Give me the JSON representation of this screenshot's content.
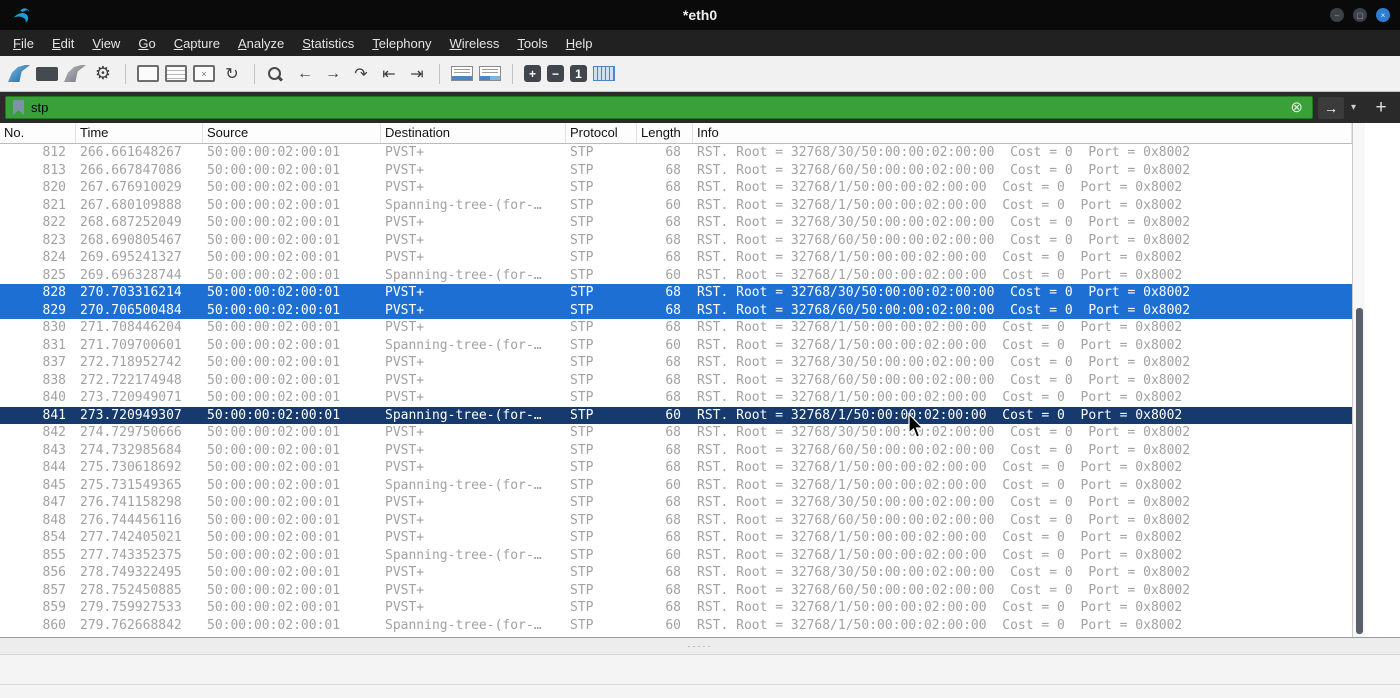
{
  "window": {
    "title": "*eth0"
  },
  "menu": {
    "items": [
      "File",
      "Edit",
      "View",
      "Go",
      "Capture",
      "Analyze",
      "Statistics",
      "Telephony",
      "Wireless",
      "Tools",
      "Help"
    ]
  },
  "toolbar": {
    "items": [
      {
        "name": "start-capture",
        "cls": "i-fin i-fin-blue",
        "glyph": ""
      },
      {
        "name": "stop-capture",
        "cls": "i-stop",
        "glyph": ""
      },
      {
        "name": "restart-capture",
        "cls": "i-fin i-fin-gray",
        "glyph": ""
      },
      {
        "name": "capture-options",
        "cls": "i-gear",
        "glyph": "⚙"
      },
      {
        "sep": true
      },
      {
        "name": "open-file",
        "cls": "i-doc",
        "glyph": ""
      },
      {
        "name": "save-file",
        "cls": "i-doc i-doc-grid",
        "glyph": ""
      },
      {
        "name": "close-file",
        "cls": "i-doc",
        "glyph": "×"
      },
      {
        "name": "reload-file",
        "cls": "",
        "glyph": "↻"
      },
      {
        "sep": true
      },
      {
        "name": "find-packet",
        "cls": "i-mag",
        "glyph": ""
      },
      {
        "name": "previous-packet",
        "cls": "",
        "glyph": "←"
      },
      {
        "name": "next-packet",
        "cls": "",
        "glyph": "→"
      },
      {
        "name": "goto-packet",
        "cls": "",
        "glyph": "↷"
      },
      {
        "name": "first-packet",
        "cls": "",
        "glyph": "⇤"
      },
      {
        "name": "last-packet",
        "cls": "",
        "glyph": "⇥"
      },
      {
        "sep": true
      },
      {
        "name": "autoscroll",
        "cls": "i-panel i-panel-blue",
        "glyph": ""
      },
      {
        "name": "colorize",
        "cls": "i-panel i-panel-color",
        "glyph": ""
      },
      {
        "sep": true
      },
      {
        "name": "zoom-in",
        "cls": "i-zoom",
        "glyph": "+"
      },
      {
        "name": "zoom-out",
        "cls": "i-zoom",
        "glyph": "−"
      },
      {
        "name": "zoom-100",
        "cls": "i-zoom",
        "glyph": "1"
      },
      {
        "name": "resize-columns",
        "cls": "i-grid",
        "glyph": ""
      }
    ]
  },
  "filter": {
    "value": "stp",
    "clear_glyph": "⊗",
    "apply_glyph": "→",
    "caret_glyph": "▾",
    "add_glyph": "+"
  },
  "columns": [
    "No.",
    "Time",
    "Source",
    "Destination",
    "Protocol",
    "Length",
    "Info"
  ],
  "packets": [
    {
      "no": "812",
      "time": "266.661648267",
      "src": "50:00:00:02:00:01",
      "dst": "PVST+",
      "proto": "STP",
      "len": "68",
      "info": "RST. Root = 32768/30/50:00:00:02:00:00  Cost = 0  Port = 0x8002",
      "state": "normal"
    },
    {
      "no": "813",
      "time": "266.667847086",
      "src": "50:00:00:02:00:01",
      "dst": "PVST+",
      "proto": "STP",
      "len": "68",
      "info": "RST. Root = 32768/60/50:00:00:02:00:00  Cost = 0  Port = 0x8002",
      "state": "normal"
    },
    {
      "no": "820",
      "time": "267.676910029",
      "src": "50:00:00:02:00:01",
      "dst": "PVST+",
      "proto": "STP",
      "len": "68",
      "info": "RST. Root = 32768/1/50:00:00:02:00:00  Cost = 0  Port = 0x8002",
      "state": "normal"
    },
    {
      "no": "821",
      "time": "267.680109888",
      "src": "50:00:00:02:00:01",
      "dst": "Spanning-tree-(for-…",
      "proto": "STP",
      "len": "60",
      "info": "RST. Root = 32768/1/50:00:00:02:00:00  Cost = 0  Port = 0x8002",
      "state": "normal"
    },
    {
      "no": "822",
      "time": "268.687252049",
      "src": "50:00:00:02:00:01",
      "dst": "PVST+",
      "proto": "STP",
      "len": "68",
      "info": "RST. Root = 32768/30/50:00:00:02:00:00  Cost = 0  Port = 0x8002",
      "state": "normal"
    },
    {
      "no": "823",
      "time": "268.690805467",
      "src": "50:00:00:02:00:01",
      "dst": "PVST+",
      "proto": "STP",
      "len": "68",
      "info": "RST. Root = 32768/60/50:00:00:02:00:00  Cost = 0  Port = 0x8002",
      "state": "normal"
    },
    {
      "no": "824",
      "time": "269.695241327",
      "src": "50:00:00:02:00:01",
      "dst": "PVST+",
      "proto": "STP",
      "len": "68",
      "info": "RST. Root = 32768/1/50:00:00:02:00:00  Cost = 0  Port = 0x8002",
      "state": "normal"
    },
    {
      "no": "825",
      "time": "269.696328744",
      "src": "50:00:00:02:00:01",
      "dst": "Spanning-tree-(for-…",
      "proto": "STP",
      "len": "60",
      "info": "RST. Root = 32768/1/50:00:00:02:00:00  Cost = 0  Port = 0x8002",
      "state": "normal"
    },
    {
      "no": "828",
      "time": "270.703316214",
      "src": "50:00:00:02:00:01",
      "dst": "PVST+",
      "proto": "STP",
      "len": "68",
      "info": "RST. Root = 32768/30/50:00:00:02:00:00  Cost = 0  Port = 0x8002",
      "state": "selected"
    },
    {
      "no": "829",
      "time": "270.706500484",
      "src": "50:00:00:02:00:01",
      "dst": "PVST+",
      "proto": "STP",
      "len": "68",
      "info": "RST. Root = 32768/60/50:00:00:02:00:00  Cost = 0  Port = 0x8002",
      "state": "selected"
    },
    {
      "no": "830",
      "time": "271.708446204",
      "src": "50:00:00:02:00:01",
      "dst": "PVST+",
      "proto": "STP",
      "len": "68",
      "info": "RST. Root = 32768/1/50:00:00:02:00:00  Cost = 0  Port = 0x8002",
      "state": "normal"
    },
    {
      "no": "831",
      "time": "271.709700601",
      "src": "50:00:00:02:00:01",
      "dst": "Spanning-tree-(for-…",
      "proto": "STP",
      "len": "60",
      "info": "RST. Root = 32768/1/50:00:00:02:00:00  Cost = 0  Port = 0x8002",
      "state": "normal"
    },
    {
      "no": "837",
      "time": "272.718952742",
      "src": "50:00:00:02:00:01",
      "dst": "PVST+",
      "proto": "STP",
      "len": "68",
      "info": "RST. Root = 32768/30/50:00:00:02:00:00  Cost = 0  Port = 0x8002",
      "state": "normal"
    },
    {
      "no": "838",
      "time": "272.722174948",
      "src": "50:00:00:02:00:01",
      "dst": "PVST+",
      "proto": "STP",
      "len": "68",
      "info": "RST. Root = 32768/60/50:00:00:02:00:00  Cost = 0  Port = 0x8002",
      "state": "normal"
    },
    {
      "no": "840",
      "time": "273.720949071",
      "src": "50:00:00:02:00:01",
      "dst": "PVST+",
      "proto": "STP",
      "len": "68",
      "info": "RST. Root = 32768/1/50:00:00:02:00:00  Cost = 0  Port = 0x8002",
      "state": "normal"
    },
    {
      "no": "841",
      "time": "273.720949307",
      "src": "50:00:00:02:00:01",
      "dst": "Spanning-tree-(for-…",
      "proto": "STP",
      "len": "60",
      "info": "RST. Root = 32768/1/50:00:00:02:00:00  Cost = 0  Port = 0x8002",
      "state": "current"
    },
    {
      "no": "842",
      "time": "274.729750666",
      "src": "50:00:00:02:00:01",
      "dst": "PVST+",
      "proto": "STP",
      "len": "68",
      "info": "RST. Root = 32768/30/50:00:00:02:00:00  Cost = 0  Port = 0x8002",
      "state": "normal"
    },
    {
      "no": "843",
      "time": "274.732985684",
      "src": "50:00:00:02:00:01",
      "dst": "PVST+",
      "proto": "STP",
      "len": "68",
      "info": "RST. Root = 32768/60/50:00:00:02:00:00  Cost = 0  Port = 0x8002",
      "state": "normal"
    },
    {
      "no": "844",
      "time": "275.730618692",
      "src": "50:00:00:02:00:01",
      "dst": "PVST+",
      "proto": "STP",
      "len": "68",
      "info": "RST. Root = 32768/1/50:00:00:02:00:00  Cost = 0  Port = 0x8002",
      "state": "normal"
    },
    {
      "no": "845",
      "time": "275.731549365",
      "src": "50:00:00:02:00:01",
      "dst": "Spanning-tree-(for-…",
      "proto": "STP",
      "len": "60",
      "info": "RST. Root = 32768/1/50:00:00:02:00:00  Cost = 0  Port = 0x8002",
      "state": "normal"
    },
    {
      "no": "847",
      "time": "276.741158298",
      "src": "50:00:00:02:00:01",
      "dst": "PVST+",
      "proto": "STP",
      "len": "68",
      "info": "RST. Root = 32768/30/50:00:00:02:00:00  Cost = 0  Port = 0x8002",
      "state": "normal"
    },
    {
      "no": "848",
      "time": "276.744456116",
      "src": "50:00:00:02:00:01",
      "dst": "PVST+",
      "proto": "STP",
      "len": "68",
      "info": "RST. Root = 32768/60/50:00:00:02:00:00  Cost = 0  Port = 0x8002",
      "state": "normal"
    },
    {
      "no": "854",
      "time": "277.742405021",
      "src": "50:00:00:02:00:01",
      "dst": "PVST+",
      "proto": "STP",
      "len": "68",
      "info": "RST. Root = 32768/1/50:00:00:02:00:00  Cost = 0  Port = 0x8002",
      "state": "normal"
    },
    {
      "no": "855",
      "time": "277.743352375",
      "src": "50:00:00:02:00:01",
      "dst": "Spanning-tree-(for-…",
      "proto": "STP",
      "len": "60",
      "info": "RST. Root = 32768/1/50:00:00:02:00:00  Cost = 0  Port = 0x8002",
      "state": "normal"
    },
    {
      "no": "856",
      "time": "278.749322495",
      "src": "50:00:00:02:00:01",
      "dst": "PVST+",
      "proto": "STP",
      "len": "68",
      "info": "RST. Root = 32768/30/50:00:00:02:00:00  Cost = 0  Port = 0x8002",
      "state": "normal"
    },
    {
      "no": "857",
      "time": "278.752450885",
      "src": "50:00:00:02:00:01",
      "dst": "PVST+",
      "proto": "STP",
      "len": "68",
      "info": "RST. Root = 32768/60/50:00:00:02:00:00  Cost = 0  Port = 0x8002",
      "state": "normal"
    },
    {
      "no": "859",
      "time": "279.759927533",
      "src": "50:00:00:02:00:01",
      "dst": "PVST+",
      "proto": "STP",
      "len": "68",
      "info": "RST. Root = 32768/1/50:00:00:02:00:00  Cost = 0  Port = 0x8002",
      "state": "normal"
    },
    {
      "no": "860",
      "time": "279.762668842",
      "src": "50:00:00:02:00:01",
      "dst": "Spanning-tree-(for-…",
      "proto": "STP",
      "len": "60",
      "info": "RST. Root = 32768/1/50:00:00:02:00:00  Cost = 0  Port = 0x8002",
      "state": "normal"
    }
  ],
  "panes": {
    "splitter_dots": "·····"
  },
  "colors": {
    "selected_row": "#1e6fd4",
    "current_row": "#163a6e",
    "filter_valid": "#3aa13a",
    "titlebar": "#0a0a0a"
  }
}
